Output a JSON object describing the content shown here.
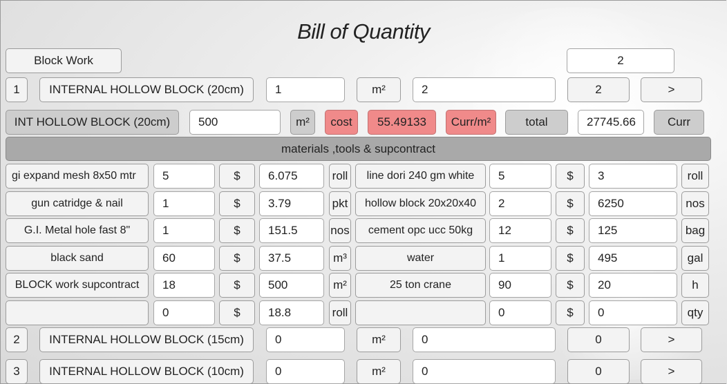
{
  "title": "Bill of Quantity",
  "section": {
    "label": "Block Work",
    "value": "2"
  },
  "items": [
    {
      "no": "1",
      "name": "INTERNAL HOLLOW BLOCK (20cm)",
      "qty": "1",
      "unit": "m²",
      "area": "2",
      "count": "2",
      "next": ">"
    },
    {
      "no": "2",
      "name": "INTERNAL HOLLOW BLOCK (15cm)",
      "qty": "0",
      "unit": "m²",
      "area": "0",
      "count": "0",
      "next": ">"
    },
    {
      "no": "3",
      "name": "INTERNAL HOLLOW BLOCK (10cm)",
      "qty": "0",
      "unit": "m²",
      "area": "0",
      "count": "0",
      "next": ">"
    }
  ],
  "calc": {
    "name": "INT HOLLOW BLOCK (20cm)",
    "amount": "500",
    "unit": "m²",
    "cost_label": "cost",
    "cost_value": "55.49133",
    "curr_per_unit": "Curr/m²",
    "total_label": "total",
    "total_value": "27745.66",
    "curr": "Curr"
  },
  "materials_header": "materials ,tools & supcontract",
  "materials_left": [
    {
      "name": "gi expand mesh 8x50 mtr",
      "qty": "5",
      "currency": "$",
      "price": "6.075",
      "unit": "roll"
    },
    {
      "name": "gun catridge & nail",
      "qty": "1",
      "currency": "$",
      "price": "3.79",
      "unit": "pkt"
    },
    {
      "name": "G.I. Metal hole fast 8\"",
      "qty": "1",
      "currency": "$",
      "price": "151.5",
      "unit": "nos"
    },
    {
      "name": "black sand",
      "qty": "60",
      "currency": "$",
      "price": "37.5",
      "unit": "m³"
    },
    {
      "name": "BLOCK work supcontract",
      "qty": "18",
      "currency": "$",
      "price": "500",
      "unit": "m²"
    },
    {
      "name": "",
      "qty": "0",
      "currency": "$",
      "price": "18.8",
      "unit": "roll"
    }
  ],
  "materials_right": [
    {
      "name": "line dori 240 gm white",
      "qty": "5",
      "currency": "$",
      "price": "3",
      "unit": "roll"
    },
    {
      "name": "hollow block 20x20x40",
      "qty": "2",
      "currency": "$",
      "price": "6250",
      "unit": "nos"
    },
    {
      "name": "cement opc ucc 50kg",
      "qty": "12",
      "currency": "$",
      "price": "125",
      "unit": "bag"
    },
    {
      "name": "water",
      "qty": "1",
      "currency": "$",
      "price": "495",
      "unit": "gal"
    },
    {
      "name": "25 ton crane",
      "qty": "90",
      "currency": "$",
      "price": "20",
      "unit": "h"
    },
    {
      "name": "",
      "qty": "0",
      "currency": "$",
      "price": "0",
      "unit": "qty"
    }
  ]
}
